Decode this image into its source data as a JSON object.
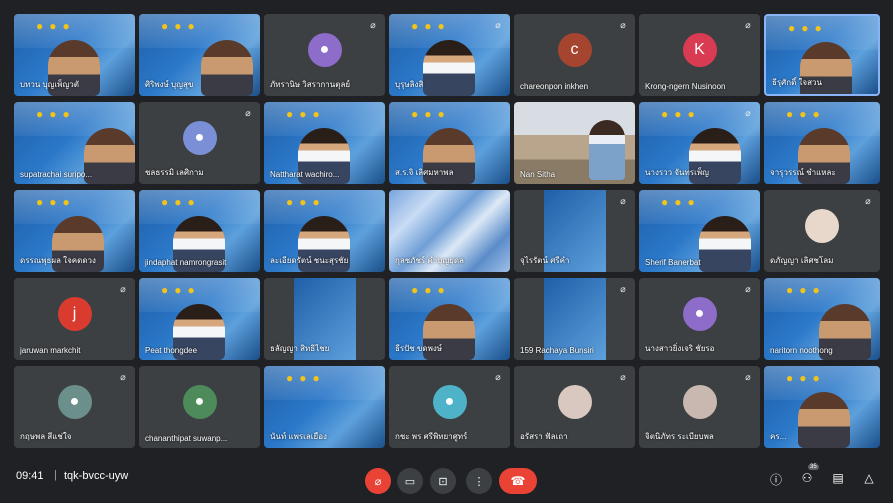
{
  "meeting": {
    "time": "09:41",
    "separator": "|",
    "code": "tqk-bvcc-uyw",
    "participant_count": "35"
  },
  "tiles": [
    "บทวน บุญเพ็ญวตั",
    "ศิริพงษ์ บุญสุข",
    "ภัทรานิษ วิสรากานตุลย์",
    "บุรุษลิงสิ",
    "chareonpon inkhen",
    "Krong-ngern Nusinoon",
    "ธีรุศักดิ์ ใจสวน",
    "supatrachai suripo...",
    "ชลธรรมิ เลศิกาม",
    "Nattharat wachiro...",
    "ส.ร.จิ  เลิศมหาพล",
    "Nan Sitha",
    "นางรวว จันทรเพ็ญ",
    "จารุวรรณ์ ชำแหละ",
    "ดรรณพุธผล  ใจคดดวง",
    "jindaphat namrongrasit",
    "ละเอียดรัตน์ ชนะสุรชัย",
    "กุลชภัชร์ คำบุญยุดล",
    "จุไรรัตน์ ศรีคำ",
    "Sherif Banerbat",
    "ดภัญญา เลิศชโลม",
    "jaruwan markchit",
    "Peat thongdee",
    "ธลัญญา สิทธิไชย",
    "ธีรปัช ขดพงษ์",
    "159 Rachaya Bunsiri",
    "นางสาวยิ่งเจริ ชัยรอ",
    "naritorn noothong",
    "กฤษพล สีแช่ใจ",
    "chananthipat suwanp...",
    "นันท์ แพรเลเยือง",
    "กชะ พร ศรีพิทยาศูทร์",
    "อรัสรา ฟัลเถา",
    "จิตนิภัทร ระเบียบพล",
    "คร..."
  ]
}
